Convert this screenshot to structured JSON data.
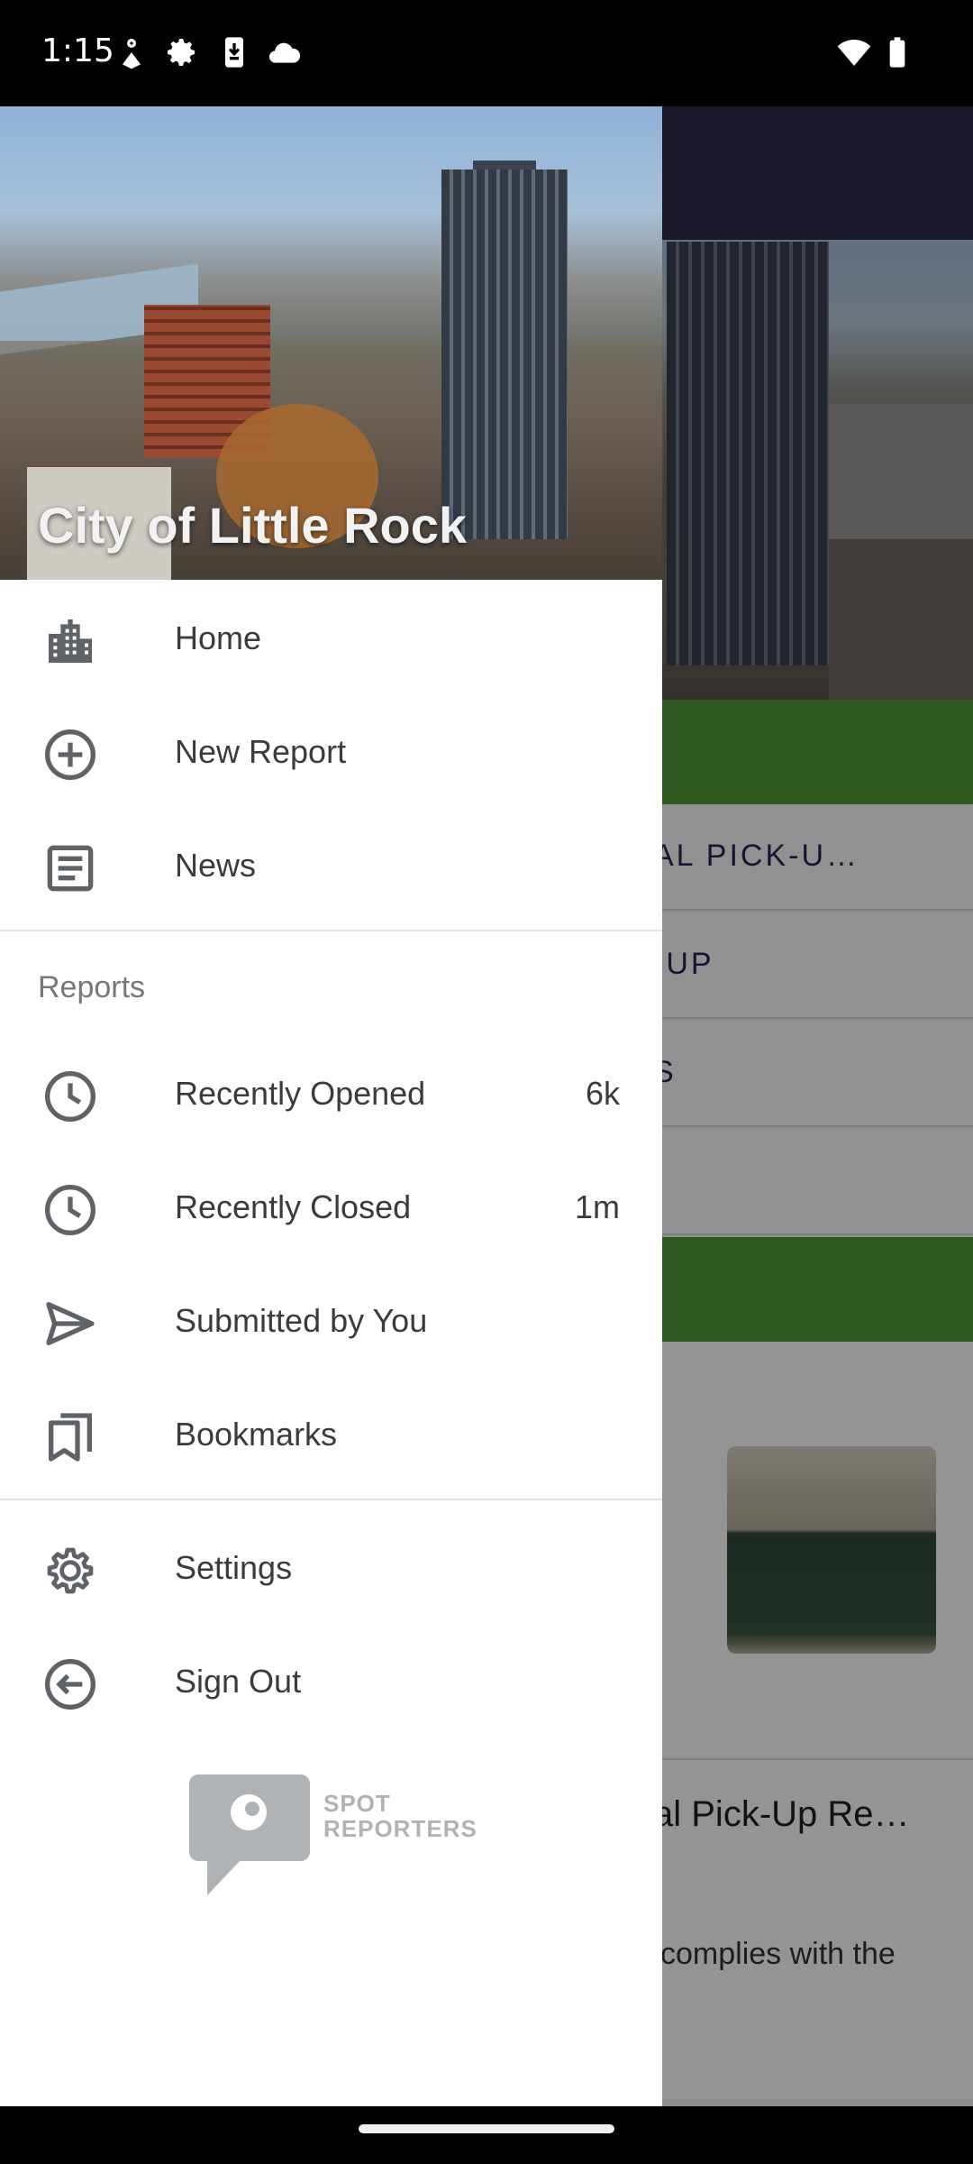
{
  "status_bar": {
    "time": "1:15",
    "left_icons": [
      "person-pin-icon",
      "settings-icon",
      "download-icon",
      "cloud-icon"
    ],
    "right_icons": [
      "wifi-icon",
      "battery-icon"
    ]
  },
  "background_app": {
    "rows": [
      "AL PICK-U…",
      "-UP",
      "S"
    ],
    "card_title": "al Pick-Up Re…",
    "card_body": "complies with the",
    "accent_green": "#4f9a3a",
    "topbar_color": "#2a2a48"
  },
  "drawer": {
    "header_title": "City of Little Rock",
    "primary_items": [
      {
        "label": "Home",
        "icon": "city-buildings-icon"
      },
      {
        "label": "New Report",
        "icon": "add-circle-icon"
      },
      {
        "label": "News",
        "icon": "article-icon"
      }
    ],
    "section_header": "Reports",
    "report_items": [
      {
        "label": "Recently Opened",
        "icon": "clock-icon",
        "count": "6k"
      },
      {
        "label": "Recently Closed",
        "icon": "clock-icon",
        "count": "1m"
      },
      {
        "label": "Submitted by You",
        "icon": "send-icon",
        "count": ""
      },
      {
        "label": "Bookmarks",
        "icon": "bookmarks-icon",
        "count": ""
      }
    ],
    "footer_items": [
      {
        "label": "Settings",
        "icon": "gear-icon"
      },
      {
        "label": "Sign Out",
        "icon": "sign-out-icon"
      }
    ],
    "brand": {
      "line1": "SPOT",
      "line2": "REPORTERS"
    }
  }
}
